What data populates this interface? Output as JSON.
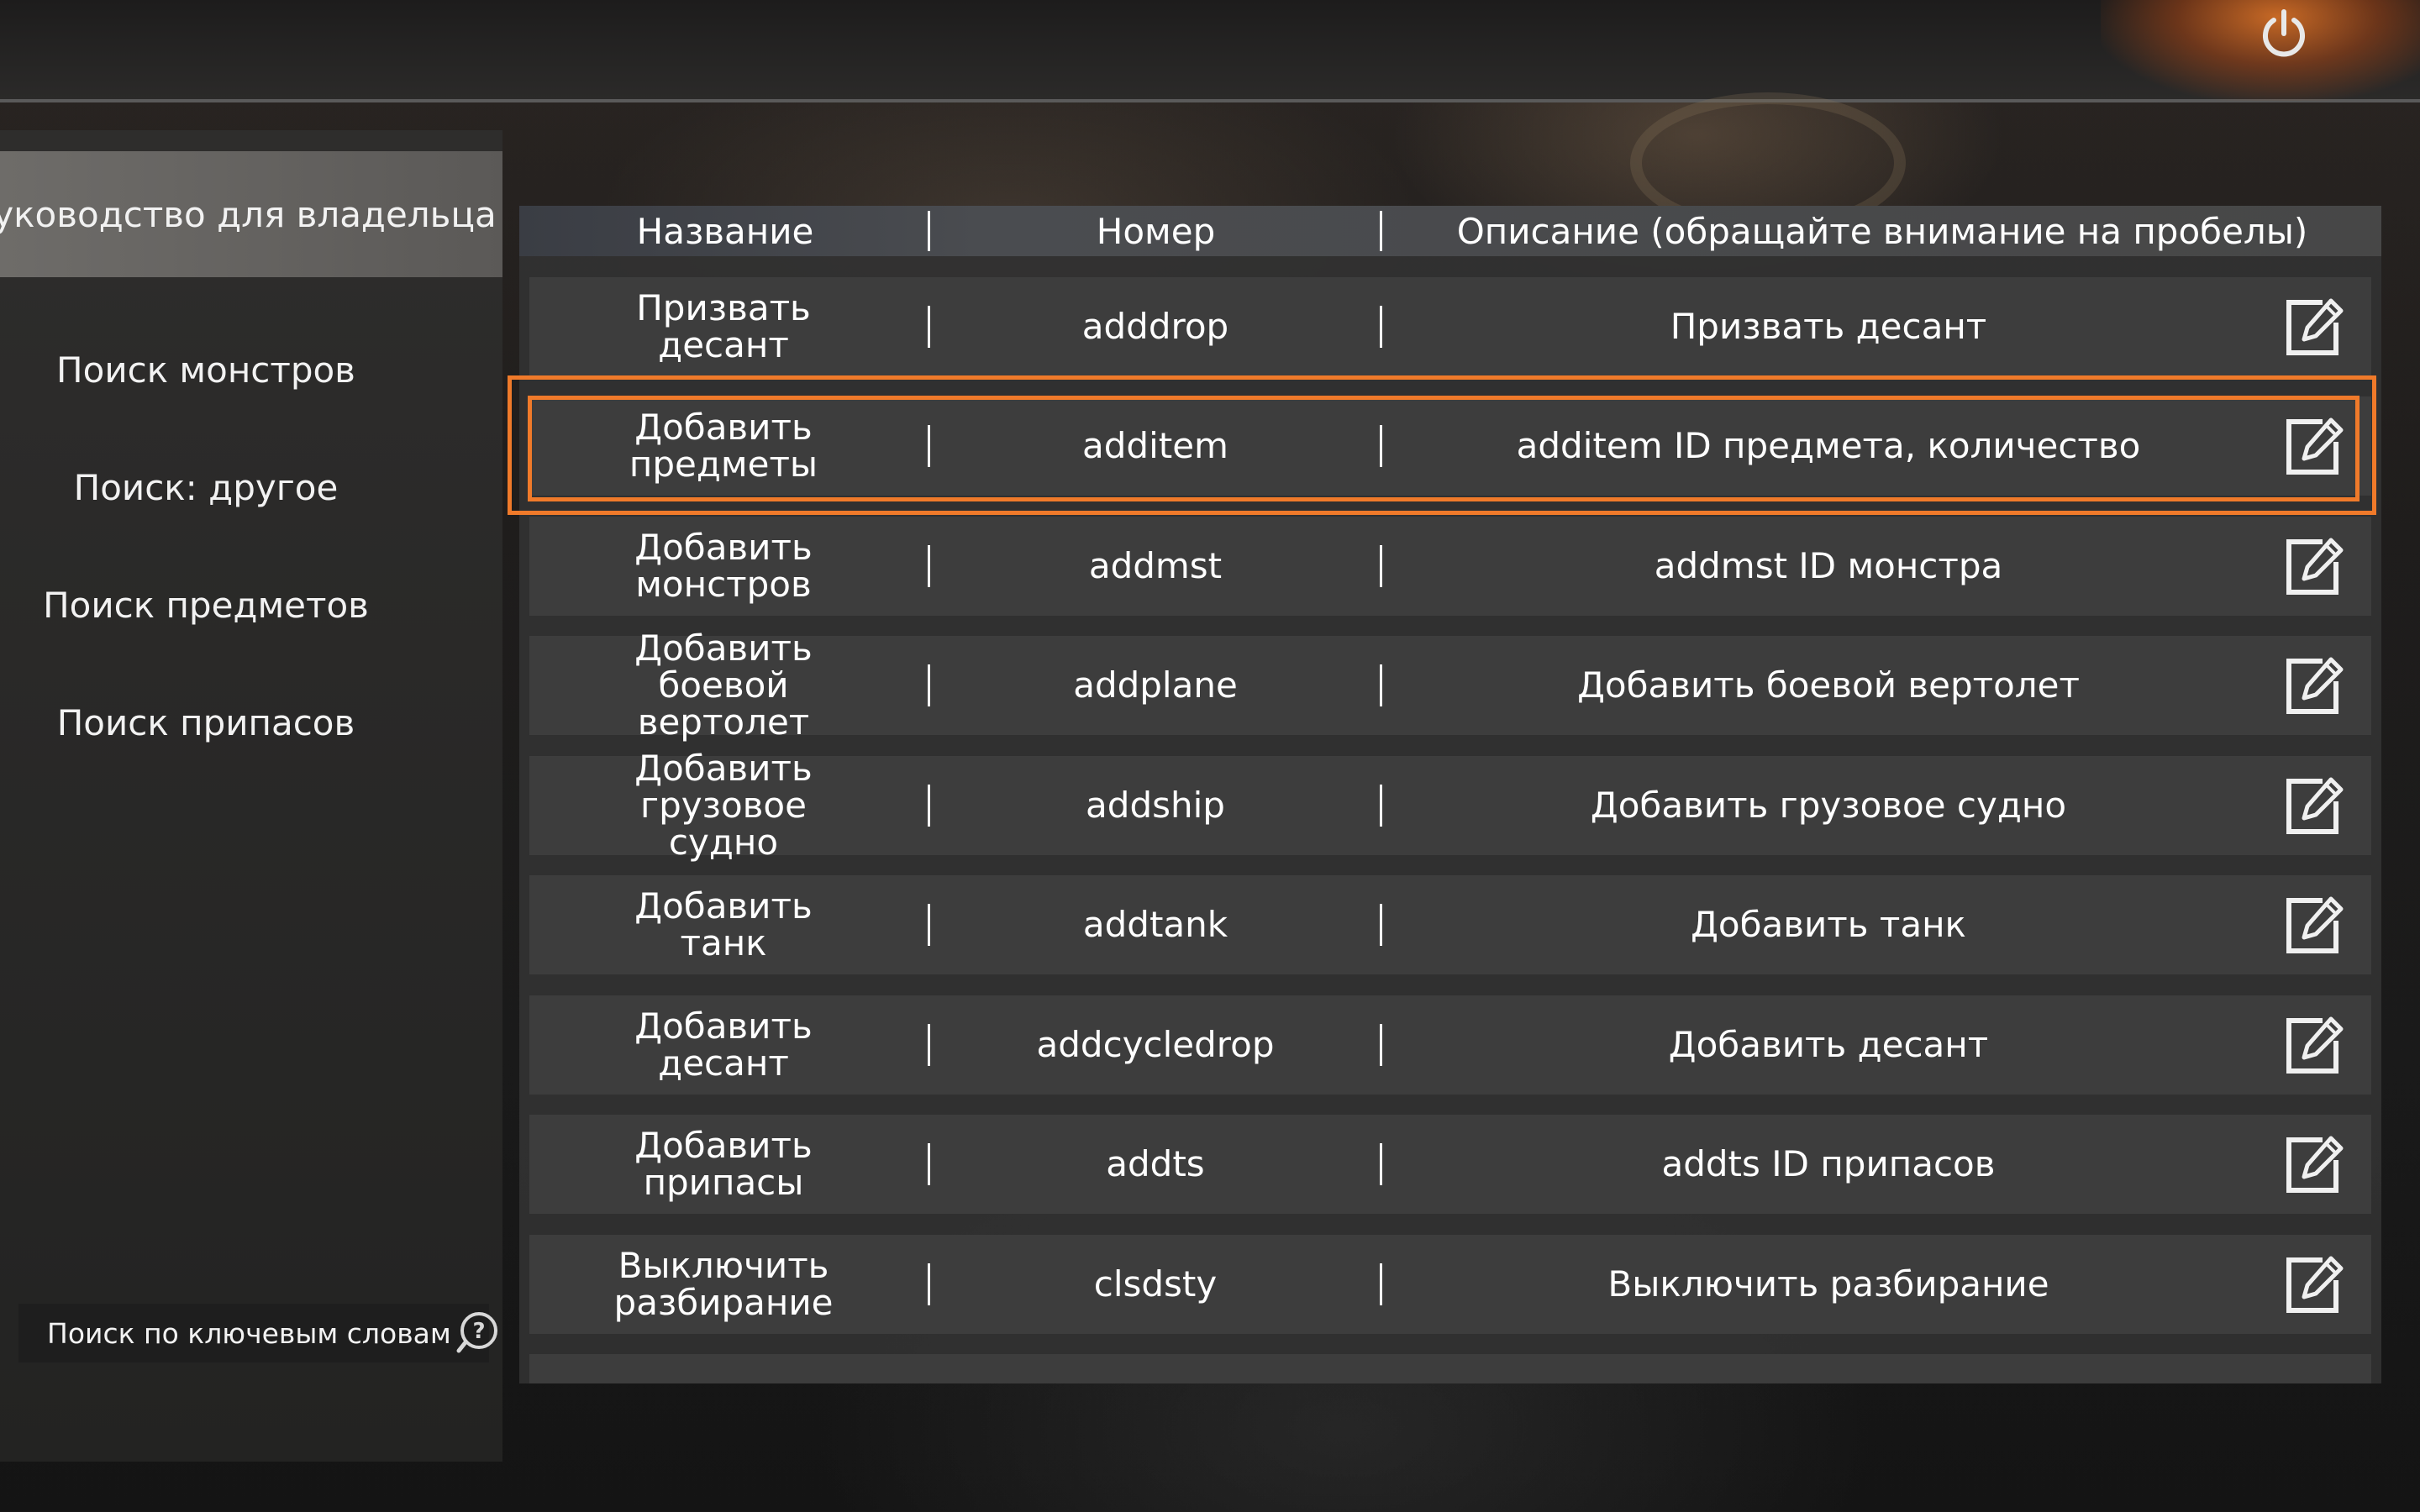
{
  "sidebar": {
    "items": [
      {
        "label": "Руководство для владельца"
      },
      {
        "label": "Поиск монстров"
      },
      {
        "label": "Поиск: другое"
      },
      {
        "label": "Поиск предметов"
      },
      {
        "label": "Поиск припасов"
      }
    ],
    "search_label": "Поиск по ключевым словам"
  },
  "table": {
    "columns": [
      "Название",
      "Номер",
      "Описание (обращайте внимание на пробелы)"
    ],
    "rows": [
      {
        "name": "Призвать десант",
        "code": "adddrop",
        "description": "Призвать десант"
      },
      {
        "name": "Добавить предметы",
        "code": "additem",
        "description": "additem ID предмета, количество"
      },
      {
        "name": "Добавить монстров",
        "code": "addmst",
        "description": "addmst ID монстра"
      },
      {
        "name": "Добавить боевой вертолет",
        "code": "addplane",
        "description": "Добавить боевой вертолет"
      },
      {
        "name": "Добавить грузовое судно",
        "code": "addship",
        "description": "Добавить грузовое судно"
      },
      {
        "name": "Добавить танк",
        "code": "addtank",
        "description": "Добавить танк"
      },
      {
        "name": "Добавить десант",
        "code": "addcycledrop",
        "description": "Добавить десант"
      },
      {
        "name": "Добавить припасы",
        "code": "addts",
        "description": "addts ID припасов"
      },
      {
        "name": "Выключить разбирание",
        "code": "clsdsty",
        "description": "Выключить разбирание"
      }
    ],
    "highlighted_row": "additem"
  },
  "icons": {
    "power": "power-icon",
    "help": "help-icon",
    "edit": "edit-icon"
  },
  "colors": {
    "highlight": "#f07a2a",
    "power_glow": "#ff8228"
  }
}
